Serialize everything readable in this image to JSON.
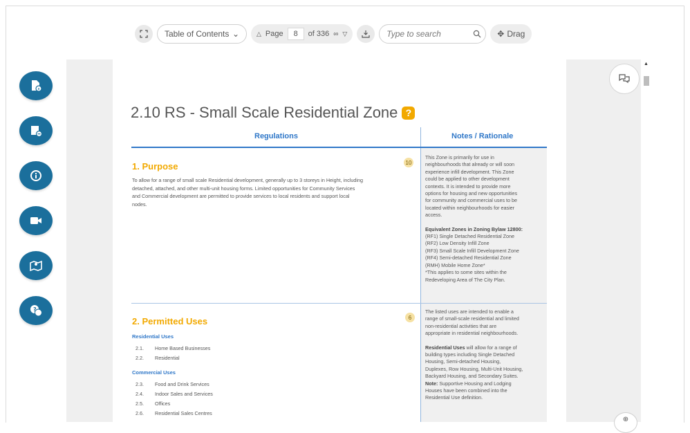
{
  "toolbar": {
    "fullscreen_icon": "expand-icon",
    "toc_label": "Table of Contents",
    "page_label": "Page",
    "page_value": "8",
    "page_total": "of 336",
    "search_placeholder": "Type to search",
    "drag_label": "Drag"
  },
  "side_buttons": [
    {
      "name": "document-info-icon"
    },
    {
      "name": "document-remove-icon"
    },
    {
      "name": "info-icon"
    },
    {
      "name": "video-icon"
    },
    {
      "name": "map-icon"
    },
    {
      "name": "help-chat-icon"
    }
  ],
  "document": {
    "title": "2.10 RS - Small Scale Residential Zone",
    "help_badge": "?",
    "col_regulations": "Regulations",
    "col_notes": "Notes / Rationale",
    "purpose": {
      "title": "1. Purpose",
      "badge": "10",
      "line1": "To allow for a range of small scale Residential development, generally up to 3 storeys in Height, including",
      "line2": "detached, attached, and other multi-unit housing forms. Limited opportunities for Community Services",
      "line3": "and Commercial development are permitted to provide services to local residents and support local",
      "line4": "nodes.",
      "notes": [
        "This Zone is primarily for use in",
        "neighbourhoods that already or will soon",
        "experience infill development. This Zone",
        "could be applied to other development",
        "contexts. It is intended to provide more",
        "options for housing and new opportunities",
        "for community and commercial uses to be",
        "located within neighbourhoods for easier",
        "access."
      ],
      "equiv_heading": "Equivalent Zones in Zoning Bylaw 12800:",
      "equiv": [
        "(RF1) Single Detached Residential Zone",
        "(RF2) Low Density Infill Zone",
        "(RF3) Small Scale Infill Development Zone",
        "(RF4) Semi-detached Residential Zone",
        "(RMH) Mobile Home Zone*",
        "*This applies to some sites within the",
        "Redeveloping Area of The City Plan."
      ]
    },
    "permitted": {
      "title": "2. Permitted Uses",
      "badge": "6",
      "residential_heading": "Residential Uses",
      "residential": [
        {
          "num": "2.1.",
          "label": "Home Based Businesses"
        },
        {
          "num": "2.2.",
          "label": "Residential"
        }
      ],
      "commercial_heading": "Commercial Uses",
      "commercial": [
        {
          "num": "2.3.",
          "label": "Food and Drink Services"
        },
        {
          "num": "2.4.",
          "label": "Indoor Sales and Services"
        },
        {
          "num": "2.5.",
          "label": "Offices"
        },
        {
          "num": "2.6.",
          "label": "Residential Sales Centres"
        }
      ],
      "notes": [
        "The listed uses are intended to enable a",
        "range of small-scale residential and limited",
        "non-residential activities that are",
        "appropriate in residential neighbourhoods."
      ],
      "res_uses_bold": "Residential Uses",
      "res_uses_rest": " will allow for a range of",
      "notes2": [
        "building types including Single Detached",
        "Housing, Semi-detached Housing,",
        "Duplexes, Row Housing, Multi-Unit Housing,",
        "Backyard Housing, and Secondary Suites."
      ],
      "note_bold": "Note:",
      "note_rest": " Supportive Housing and Lodging",
      "notes3": [
        "Houses have been combined into the",
        "Residential Use definition."
      ]
    }
  },
  "colors": {
    "fab": "#1b6f9c",
    "accent_blue": "#2f77c8",
    "accent_orange": "#f2a900"
  }
}
